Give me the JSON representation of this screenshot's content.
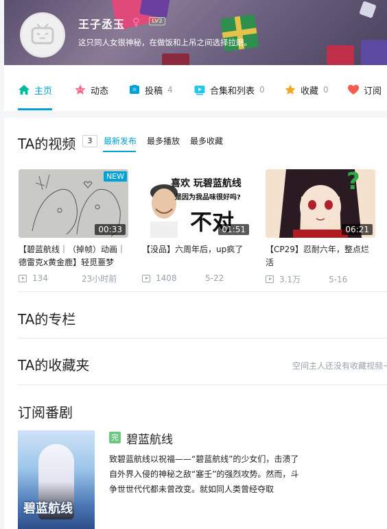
{
  "profile": {
    "username": "王子丞玉",
    "gender_symbol": "♀",
    "level": "LV2",
    "sign": "这只同人女很神秘，在做饭和上吊之间选择拉磨。"
  },
  "nav": {
    "items": [
      {
        "label": "主页",
        "count": "",
        "icon": "home-icon"
      },
      {
        "label": "动态",
        "count": "",
        "icon": "feed-icon"
      },
      {
        "label": "投稿",
        "count": "4",
        "icon": "upload-icon"
      },
      {
        "label": "合集和列表",
        "count": "0",
        "icon": "collection-icon"
      },
      {
        "label": "收藏",
        "count": "0",
        "icon": "star-icon"
      },
      {
        "label": "订阅",
        "count": "",
        "icon": "heart-icon"
      }
    ],
    "active_color": "#00a1d6"
  },
  "videos_section": {
    "title": "TA的视频",
    "count": "3",
    "tabs": [
      "最新发布",
      "最多播放",
      "最多收藏"
    ],
    "items": [
      {
        "title": "【碧蓝航线｜（掉帧）动画｜德雷克x黄金鹿】轻觅噩梦",
        "duration": "00:33",
        "badge": "NEW",
        "views": "134",
        "date": "23小时前"
      },
      {
        "title": "【没品】六周年后，up疯了",
        "duration": "01:51",
        "badge": "",
        "views": "1408",
        "date": "5-22",
        "thumb_text_1": "喜欢 玩碧蓝航线",
        "thumb_text_2": "是因为我品味很好吗?",
        "thumb_text_3": "不对"
      },
      {
        "title": "【CP29】忍耐六年，整点烂活",
        "duration": "06:21",
        "badge": "",
        "views": "3.1万",
        "date": "5-16",
        "thumb_text_1": "?"
      }
    ]
  },
  "column_section": {
    "title": "TA的专栏"
  },
  "favorites_section": {
    "title": "TA的收藏夹",
    "empty_text": "空间主人还没有收藏视频~"
  },
  "bangumi_section": {
    "title": "订阅番剧",
    "badge": "完",
    "name": "碧蓝航线",
    "cover_logo": "碧蓝航线",
    "description": "致碧蓝航线以祝福——“碧蓝航线”的少女们，击溃了自外界入侵的神秘之敌“塞壬”的强烈攻势。然而，斗争世世代代都未曾改变。就如同人类曾经夺取"
  }
}
